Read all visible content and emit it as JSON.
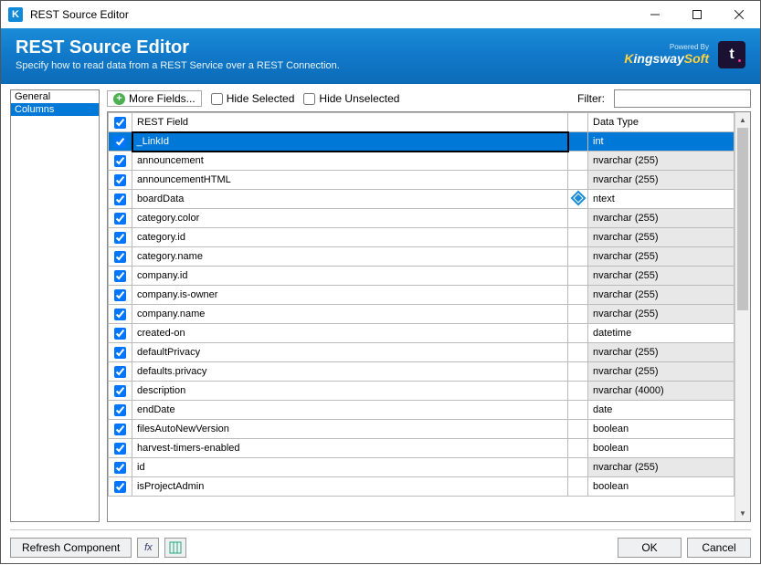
{
  "window": {
    "title": "REST Source Editor"
  },
  "header": {
    "title": "REST Source Editor",
    "subtitle": "Specify how to read data from a REST Service over a REST Connection.",
    "powered_by": "Powered By",
    "brand_k": "K",
    "brand_rest": "ingsway",
    "brand_soft": "Soft"
  },
  "sidebar": {
    "items": [
      {
        "label": "General",
        "selected": false
      },
      {
        "label": "Columns",
        "selected": true
      }
    ]
  },
  "toolbar": {
    "more_fields": "More Fields...",
    "hide_selected": "Hide Selected",
    "hide_unselected": "Hide Unselected",
    "filter_label": "Filter:",
    "filter_value": ""
  },
  "grid": {
    "headers": {
      "field": "REST Field",
      "type": "Data Type"
    },
    "selected_index": 0,
    "rows": [
      {
        "checked": true,
        "field": "_LinkId",
        "type": "int",
        "type_shaded": true,
        "selected": true
      },
      {
        "checked": true,
        "field": "announcement",
        "type": "nvarchar (255)",
        "type_shaded": true
      },
      {
        "checked": true,
        "field": "announcementHTML",
        "type": "nvarchar (255)",
        "type_shaded": true
      },
      {
        "checked": true,
        "field": "boardData",
        "type": "ntext",
        "type_shaded": false,
        "icon": "diamond"
      },
      {
        "checked": true,
        "field": "category.color",
        "type": "nvarchar (255)",
        "type_shaded": true
      },
      {
        "checked": true,
        "field": "category.id",
        "type": "nvarchar (255)",
        "type_shaded": true
      },
      {
        "checked": true,
        "field": "category.name",
        "type": "nvarchar (255)",
        "type_shaded": true
      },
      {
        "checked": true,
        "field": "company.id",
        "type": "nvarchar (255)",
        "type_shaded": true
      },
      {
        "checked": true,
        "field": "company.is-owner",
        "type": "nvarchar (255)",
        "type_shaded": true
      },
      {
        "checked": true,
        "field": "company.name",
        "type": "nvarchar (255)",
        "type_shaded": true
      },
      {
        "checked": true,
        "field": "created-on",
        "type": "datetime",
        "type_shaded": false
      },
      {
        "checked": true,
        "field": "defaultPrivacy",
        "type": "nvarchar (255)",
        "type_shaded": true
      },
      {
        "checked": true,
        "field": "defaults.privacy",
        "type": "nvarchar (255)",
        "type_shaded": true
      },
      {
        "checked": true,
        "field": "description",
        "type": "nvarchar (4000)",
        "type_shaded": true
      },
      {
        "checked": true,
        "field": "endDate",
        "type": "date",
        "type_shaded": false
      },
      {
        "checked": true,
        "field": "filesAutoNewVersion",
        "type": "boolean",
        "type_shaded": false
      },
      {
        "checked": true,
        "field": "harvest-timers-enabled",
        "type": "boolean",
        "type_shaded": false
      },
      {
        "checked": true,
        "field": "id",
        "type": "nvarchar (255)",
        "type_shaded": true
      },
      {
        "checked": true,
        "field": "isProjectAdmin",
        "type": "boolean",
        "type_shaded": false
      }
    ]
  },
  "footer": {
    "refresh": "Refresh Component",
    "ok": "OK",
    "cancel": "Cancel"
  }
}
